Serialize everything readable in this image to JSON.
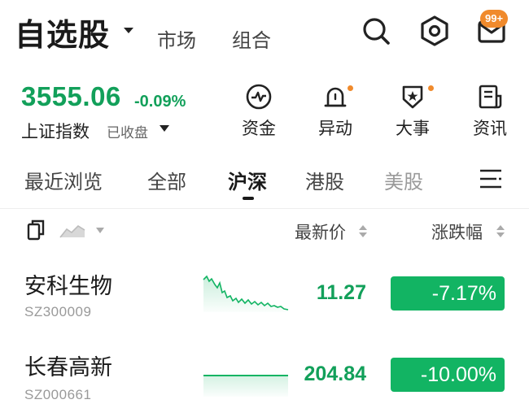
{
  "header": {
    "title": "自选股",
    "tabs": [
      "市场",
      "组合"
    ],
    "icons": [
      "search-icon",
      "settings-hex-icon",
      "mail-icon"
    ],
    "mail_badge": "99+",
    "accent_badge_color": "#f08a2c"
  },
  "index": {
    "value": "3555.06",
    "change": "-0.09%",
    "name": "上证指数",
    "status": "已收盘",
    "color": "#12a05a"
  },
  "quick_actions": [
    {
      "label": "资金",
      "icon": "fund-flow-icon",
      "has_dot": false
    },
    {
      "label": "异动",
      "icon": "alarm-bell-icon",
      "has_dot": true
    },
    {
      "label": "大事",
      "icon": "star-shield-icon",
      "has_dot": true
    },
    {
      "label": "资讯",
      "icon": "news-doc-icon",
      "has_dot": false
    }
  ],
  "categories": {
    "items": [
      "最近浏览",
      "全部",
      "沪深",
      "港股",
      "美股"
    ],
    "active": "沪深",
    "menu_icon": "menu-lines-icon"
  },
  "list_header": {
    "view_icons": [
      "copy-icon",
      "chart-trend-icon"
    ],
    "price_label": "最新价",
    "change_label": "涨跌幅"
  },
  "stocks": [
    {
      "name": "安科生物",
      "code": "SZ300009",
      "price": "11.27",
      "change": "-7.17%"
    },
    {
      "name": "长春高新",
      "code": "SZ000661",
      "price": "204.84",
      "change": "-10.00%"
    }
  ],
  "colors": {
    "down_green": "#12b463",
    "text_green": "#12a05a"
  }
}
